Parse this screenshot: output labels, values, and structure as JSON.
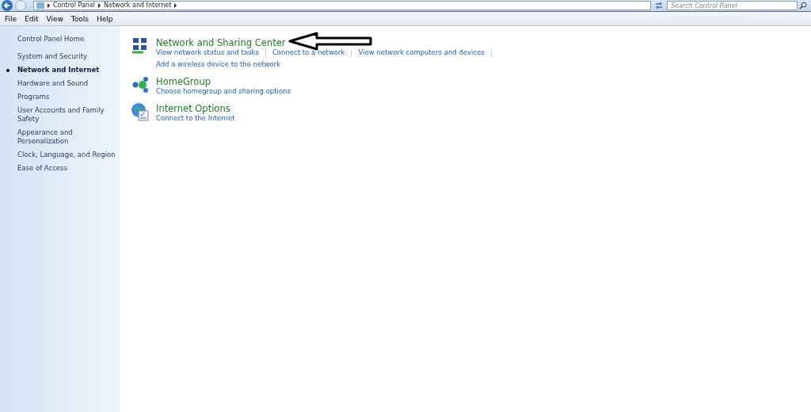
{
  "address_bar": {
    "breadcrumbs": [
      "Control Panel",
      "Network and Internet"
    ],
    "search": {
      "placeholder": "Search Control Panel"
    }
  },
  "menu_bar": [
    "File",
    "Edit",
    "View",
    "Tools",
    "Help"
  ],
  "sidebar": {
    "home": "Control Panel Home",
    "items": [
      {
        "label": "System and Security",
        "selected": false
      },
      {
        "label": "Network and Internet",
        "selected": true
      },
      {
        "label": "Hardware and Sound",
        "selected": false
      },
      {
        "label": "Programs",
        "selected": false
      },
      {
        "label": "User Accounts and Family Safety",
        "selected": false
      },
      {
        "label": "Appearance and Personalization",
        "selected": false
      },
      {
        "label": "Clock, Language, and Region",
        "selected": false
      },
      {
        "label": "Ease of Access",
        "selected": false
      }
    ]
  },
  "categories": [
    {
      "kind": "network",
      "title": "Network and Sharing Center",
      "links": [
        "View network status and tasks",
        "Connect to a network",
        "View network computers and devices",
        "Add a wireless device to the network"
      ]
    },
    {
      "kind": "homegroup",
      "title": "HomeGroup",
      "links": [
        "Choose homegroup and sharing options"
      ]
    },
    {
      "kind": "internet",
      "title": "Internet Options",
      "links": [
        "Connect to the Internet"
      ]
    }
  ]
}
